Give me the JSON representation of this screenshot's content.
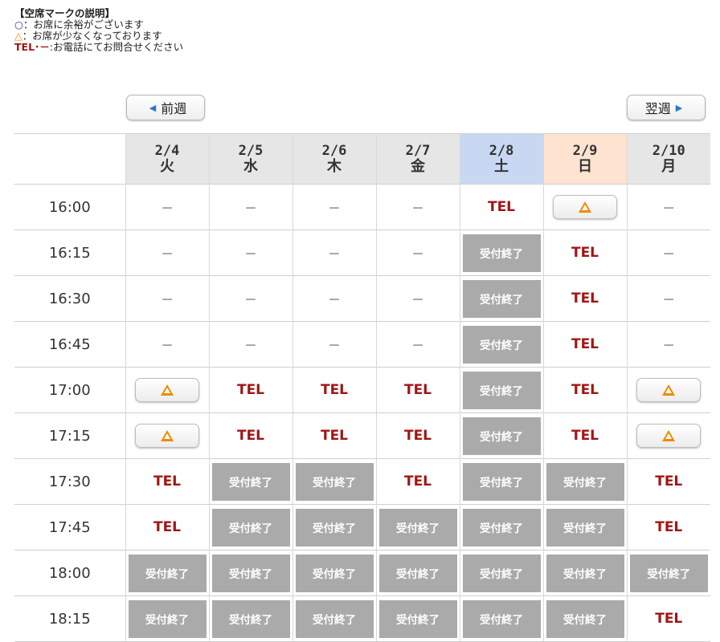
{
  "legend": {
    "title": "【空席マークの説明】",
    "circle_symbol": "○",
    "circle_text": "：お席に余裕がございます",
    "triangle_symbol": "△",
    "triangle_text": "：お席が少なくなっております",
    "tel_symbol": "TEL･－",
    "tel_text": ":お電話にてお問合せください"
  },
  "nav": {
    "prev_label": "前週",
    "next_label": "翌週"
  },
  "days": [
    {
      "date": "2/4",
      "weekday": "火",
      "type": "weekday"
    },
    {
      "date": "2/5",
      "weekday": "水",
      "type": "weekday"
    },
    {
      "date": "2/6",
      "weekday": "木",
      "type": "weekday"
    },
    {
      "date": "2/7",
      "weekday": "金",
      "type": "weekday"
    },
    {
      "date": "2/8",
      "weekday": "土",
      "type": "sat"
    },
    {
      "date": "2/9",
      "weekday": "日",
      "type": "sun"
    },
    {
      "date": "2/10",
      "weekday": "月",
      "type": "weekday"
    }
  ],
  "labels": {
    "dash": "－",
    "tel": "TEL",
    "closed": "受付終了"
  },
  "colors": {
    "triangle": "#f08a00",
    "tel": "#a01515",
    "closed_bg": "#aaaaaa",
    "saturday_header": "#c9d8f2",
    "sunday_header": "#fde3d0"
  },
  "rows": [
    {
      "time": "16:00",
      "cells": [
        "dash",
        "dash",
        "dash",
        "dash",
        "tel",
        "triangle",
        "dash"
      ]
    },
    {
      "time": "16:15",
      "cells": [
        "dash",
        "dash",
        "dash",
        "dash",
        "closed",
        "tel",
        "dash"
      ]
    },
    {
      "time": "16:30",
      "cells": [
        "dash",
        "dash",
        "dash",
        "dash",
        "closed",
        "tel",
        "dash"
      ]
    },
    {
      "time": "16:45",
      "cells": [
        "dash",
        "dash",
        "dash",
        "dash",
        "closed",
        "tel",
        "dash"
      ]
    },
    {
      "time": "17:00",
      "cells": [
        "triangle",
        "tel",
        "tel",
        "tel",
        "closed",
        "tel",
        "triangle"
      ]
    },
    {
      "time": "17:15",
      "cells": [
        "triangle",
        "tel",
        "tel",
        "tel",
        "closed",
        "tel",
        "triangle"
      ]
    },
    {
      "time": "17:30",
      "cells": [
        "tel",
        "closed",
        "closed",
        "tel",
        "closed",
        "closed",
        "tel"
      ]
    },
    {
      "time": "17:45",
      "cells": [
        "tel",
        "closed",
        "closed",
        "closed",
        "closed",
        "closed",
        "tel"
      ]
    },
    {
      "time": "18:00",
      "cells": [
        "closed",
        "closed",
        "closed",
        "closed",
        "closed",
        "closed",
        "closed"
      ]
    },
    {
      "time": "18:15",
      "cells": [
        "closed",
        "closed",
        "closed",
        "closed",
        "closed",
        "closed",
        "tel"
      ]
    }
  ]
}
